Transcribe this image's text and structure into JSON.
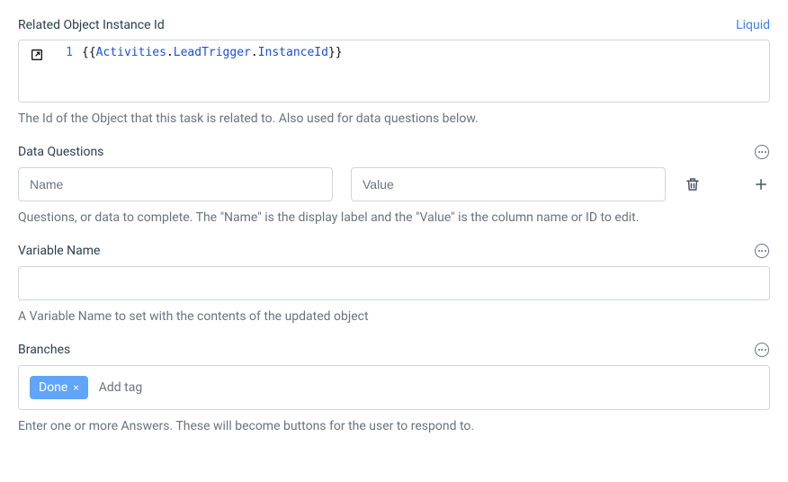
{
  "relatedObject": {
    "label": "Related Object Instance Id",
    "liquidLink": "Liquid",
    "lineNumber": "1",
    "codeTokens": {
      "open": "{{",
      "w1": "Activities",
      "d1": ".",
      "w2": "LeadTrigger",
      "d2": ".",
      "w3": "InstanceId",
      "close": "}}"
    },
    "helper": "The Id of the Object that this task is related to. Also used for data questions below."
  },
  "dataQuestions": {
    "label": "Data Questions",
    "namePlaceholder": "Name",
    "nameValue": "",
    "valuePlaceholder": "Value",
    "valueValue": "",
    "helper": "Questions, or data to complete. The \"Name\" is the display label and the \"Value\" is the column name or ID to edit."
  },
  "variableName": {
    "label": "Variable Name",
    "value": "",
    "helper": "A Variable Name to set with the contents of the updated object"
  },
  "branches": {
    "label": "Branches",
    "tag": "Done",
    "tagClose": "×",
    "addTagPlaceholder": "Add tag",
    "helper": "Enter one or more Answers. These will become buttons for the user to respond to."
  }
}
